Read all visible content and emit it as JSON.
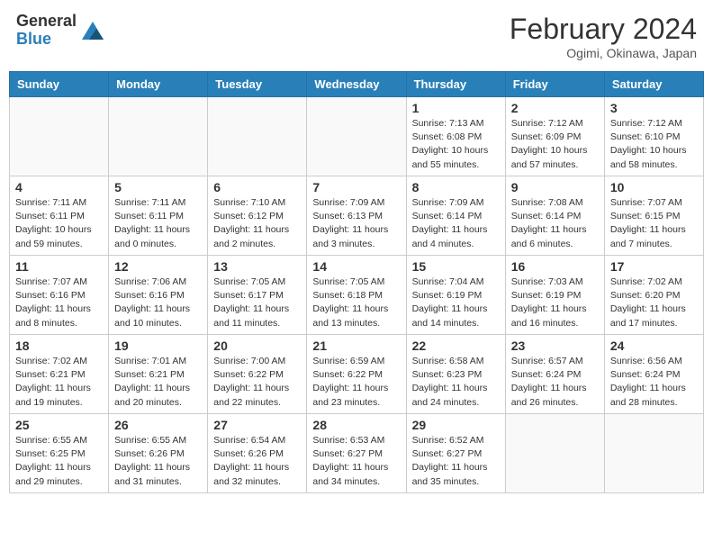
{
  "header": {
    "logo_general": "General",
    "logo_blue": "Blue",
    "title": "February 2024",
    "subtitle": "Ogimi, Okinawa, Japan"
  },
  "days_of_week": [
    "Sunday",
    "Monday",
    "Tuesday",
    "Wednesday",
    "Thursday",
    "Friday",
    "Saturday"
  ],
  "weeks": [
    [
      {
        "day": "",
        "info": ""
      },
      {
        "day": "",
        "info": ""
      },
      {
        "day": "",
        "info": ""
      },
      {
        "day": "",
        "info": ""
      },
      {
        "day": "1",
        "info": "Sunrise: 7:13 AM\nSunset: 6:08 PM\nDaylight: 10 hours and 55 minutes."
      },
      {
        "day": "2",
        "info": "Sunrise: 7:12 AM\nSunset: 6:09 PM\nDaylight: 10 hours and 57 minutes."
      },
      {
        "day": "3",
        "info": "Sunrise: 7:12 AM\nSunset: 6:10 PM\nDaylight: 10 hours and 58 minutes."
      }
    ],
    [
      {
        "day": "4",
        "info": "Sunrise: 7:11 AM\nSunset: 6:11 PM\nDaylight: 10 hours and 59 minutes."
      },
      {
        "day": "5",
        "info": "Sunrise: 7:11 AM\nSunset: 6:11 PM\nDaylight: 11 hours and 0 minutes."
      },
      {
        "day": "6",
        "info": "Sunrise: 7:10 AM\nSunset: 6:12 PM\nDaylight: 11 hours and 2 minutes."
      },
      {
        "day": "7",
        "info": "Sunrise: 7:09 AM\nSunset: 6:13 PM\nDaylight: 11 hours and 3 minutes."
      },
      {
        "day": "8",
        "info": "Sunrise: 7:09 AM\nSunset: 6:14 PM\nDaylight: 11 hours and 4 minutes."
      },
      {
        "day": "9",
        "info": "Sunrise: 7:08 AM\nSunset: 6:14 PM\nDaylight: 11 hours and 6 minutes."
      },
      {
        "day": "10",
        "info": "Sunrise: 7:07 AM\nSunset: 6:15 PM\nDaylight: 11 hours and 7 minutes."
      }
    ],
    [
      {
        "day": "11",
        "info": "Sunrise: 7:07 AM\nSunset: 6:16 PM\nDaylight: 11 hours and 8 minutes."
      },
      {
        "day": "12",
        "info": "Sunrise: 7:06 AM\nSunset: 6:16 PM\nDaylight: 11 hours and 10 minutes."
      },
      {
        "day": "13",
        "info": "Sunrise: 7:05 AM\nSunset: 6:17 PM\nDaylight: 11 hours and 11 minutes."
      },
      {
        "day": "14",
        "info": "Sunrise: 7:05 AM\nSunset: 6:18 PM\nDaylight: 11 hours and 13 minutes."
      },
      {
        "day": "15",
        "info": "Sunrise: 7:04 AM\nSunset: 6:19 PM\nDaylight: 11 hours and 14 minutes."
      },
      {
        "day": "16",
        "info": "Sunrise: 7:03 AM\nSunset: 6:19 PM\nDaylight: 11 hours and 16 minutes."
      },
      {
        "day": "17",
        "info": "Sunrise: 7:02 AM\nSunset: 6:20 PM\nDaylight: 11 hours and 17 minutes."
      }
    ],
    [
      {
        "day": "18",
        "info": "Sunrise: 7:02 AM\nSunset: 6:21 PM\nDaylight: 11 hours and 19 minutes."
      },
      {
        "day": "19",
        "info": "Sunrise: 7:01 AM\nSunset: 6:21 PM\nDaylight: 11 hours and 20 minutes."
      },
      {
        "day": "20",
        "info": "Sunrise: 7:00 AM\nSunset: 6:22 PM\nDaylight: 11 hours and 22 minutes."
      },
      {
        "day": "21",
        "info": "Sunrise: 6:59 AM\nSunset: 6:22 PM\nDaylight: 11 hours and 23 minutes."
      },
      {
        "day": "22",
        "info": "Sunrise: 6:58 AM\nSunset: 6:23 PM\nDaylight: 11 hours and 24 minutes."
      },
      {
        "day": "23",
        "info": "Sunrise: 6:57 AM\nSunset: 6:24 PM\nDaylight: 11 hours and 26 minutes."
      },
      {
        "day": "24",
        "info": "Sunrise: 6:56 AM\nSunset: 6:24 PM\nDaylight: 11 hours and 28 minutes."
      }
    ],
    [
      {
        "day": "25",
        "info": "Sunrise: 6:55 AM\nSunset: 6:25 PM\nDaylight: 11 hours and 29 minutes."
      },
      {
        "day": "26",
        "info": "Sunrise: 6:55 AM\nSunset: 6:26 PM\nDaylight: 11 hours and 31 minutes."
      },
      {
        "day": "27",
        "info": "Sunrise: 6:54 AM\nSunset: 6:26 PM\nDaylight: 11 hours and 32 minutes."
      },
      {
        "day": "28",
        "info": "Sunrise: 6:53 AM\nSunset: 6:27 PM\nDaylight: 11 hours and 34 minutes."
      },
      {
        "day": "29",
        "info": "Sunrise: 6:52 AM\nSunset: 6:27 PM\nDaylight: 11 hours and 35 minutes."
      },
      {
        "day": "",
        "info": ""
      },
      {
        "day": "",
        "info": ""
      }
    ]
  ]
}
